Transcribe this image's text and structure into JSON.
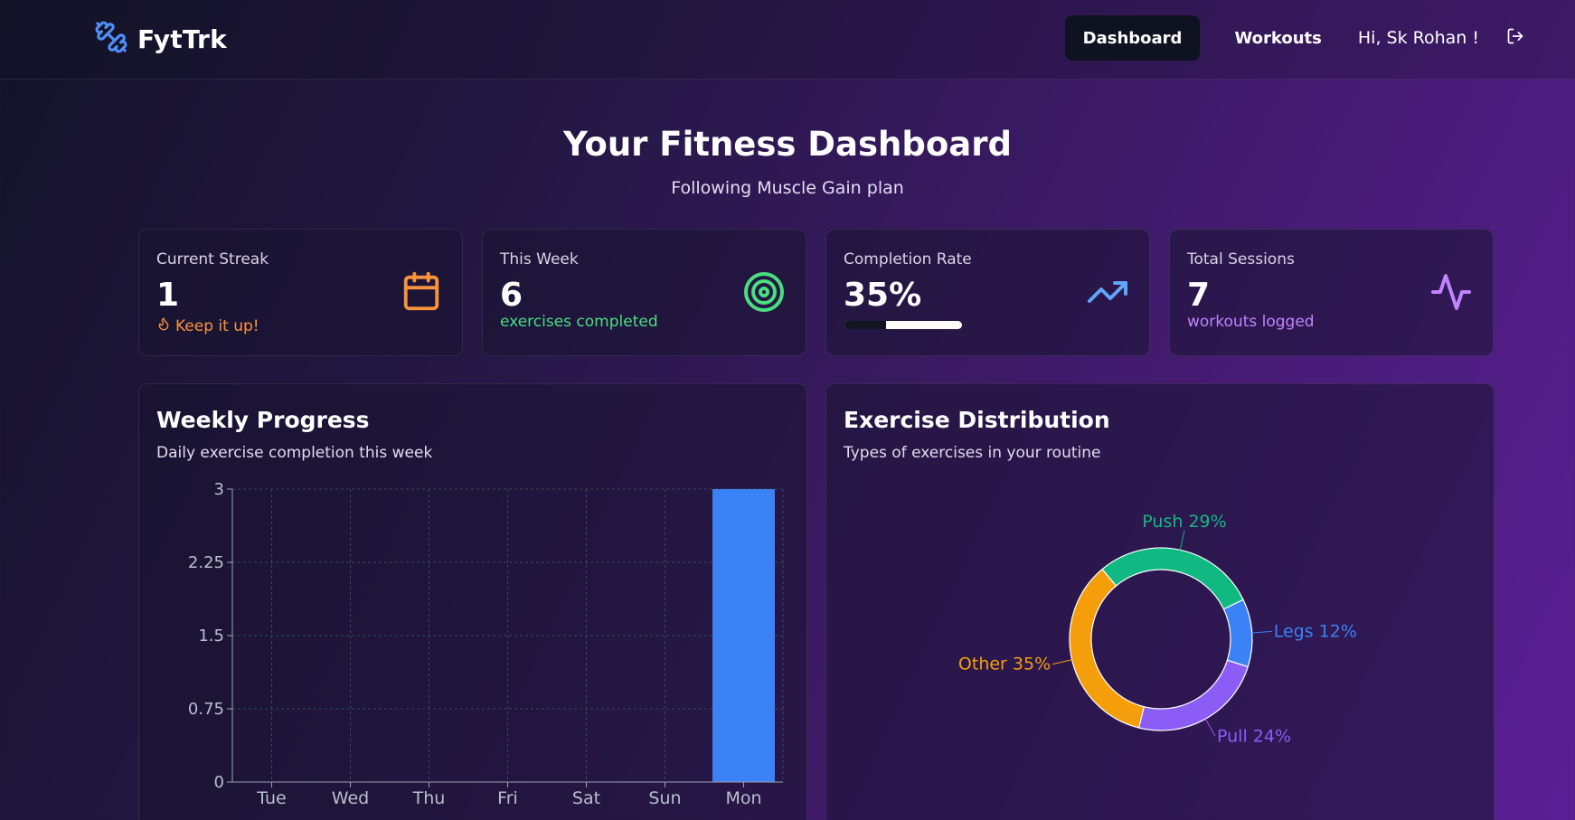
{
  "app": {
    "name": "FytTrk"
  },
  "nav": {
    "dashboard_label": "Dashboard",
    "workouts_label": "Workouts",
    "greeting": "Hi, Sk Rohan !"
  },
  "hero": {
    "title": "Your Fitness Dashboard",
    "subtitle": "Following Muscle Gain plan"
  },
  "stats": {
    "streak": {
      "label": "Current Streak",
      "value": "1",
      "note": "Keep it up!",
      "icon": "calendar-icon",
      "color": "#fb923c"
    },
    "week": {
      "label": "This Week",
      "value": "6",
      "note": "exercises completed",
      "icon": "target-icon",
      "color": "#4ade80"
    },
    "completion": {
      "label": "Completion Rate",
      "value": "35%",
      "progress": 0.35,
      "icon": "trending-up-icon",
      "color": "#60a5fa"
    },
    "sessions": {
      "label": "Total Sessions",
      "value": "7",
      "note": "workouts logged",
      "icon": "activity-icon",
      "color": "#c084fc"
    }
  },
  "weekly": {
    "title": "Weekly Progress",
    "subtitle": "Daily exercise completion this week"
  },
  "distribution": {
    "title": "Exercise Distribution",
    "subtitle": "Types of exercises in your routine"
  },
  "chart_data": [
    {
      "type": "bar",
      "categories": [
        "Tue",
        "Wed",
        "Thu",
        "Fri",
        "Sat",
        "Sun",
        "Mon"
      ],
      "values": [
        0,
        0,
        0,
        0,
        0,
        0,
        3
      ],
      "yticks": [
        "0",
        "0.75",
        "1.5",
        "2.25",
        "3"
      ],
      "ylim": [
        0,
        3
      ],
      "grid": true,
      "color": "#3b82f6"
    },
    {
      "type": "pie",
      "donut": true,
      "slices": [
        {
          "label": "Push 29%",
          "value": 29,
          "color": "#10b981"
        },
        {
          "label": "Legs 12%",
          "value": 12,
          "color": "#3b82f6"
        },
        {
          "label": "Pull 24%",
          "value": 24,
          "color": "#8b5cf6"
        },
        {
          "label": "Other 35%",
          "value": 35,
          "color": "#f59e0b"
        }
      ]
    }
  ]
}
